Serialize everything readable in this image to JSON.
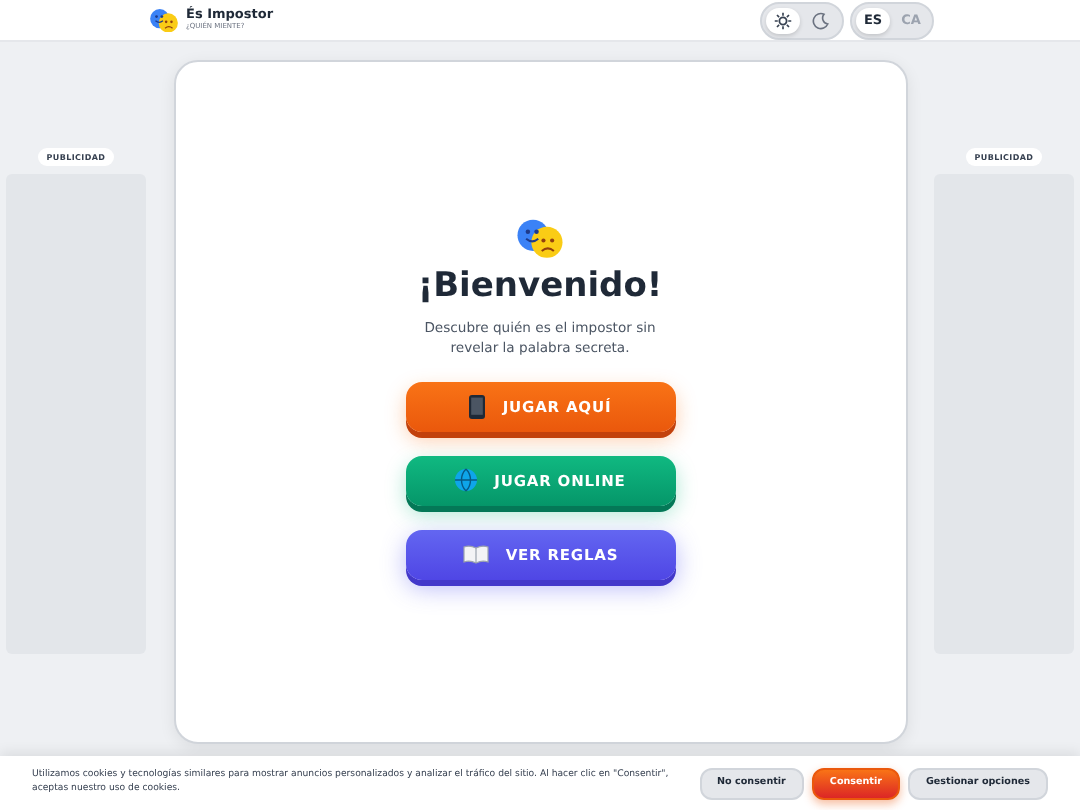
{
  "header": {
    "title": "És Impostor",
    "subtitle": "¿QUIÉN MIENTE?",
    "theme": [
      {
        "kind": "light",
        "selected": true
      },
      {
        "kind": "dark",
        "selected": false
      }
    ],
    "languages": [
      {
        "label": "ES",
        "selected": true
      },
      {
        "label": "CA",
        "selected": false
      }
    ]
  },
  "ads": [
    {
      "label": "PUBLICIDAD"
    },
    {
      "label": "PUBLICIDAD"
    }
  ],
  "main": {
    "title": "¡Bienvenido!",
    "description": "Descubre quién es el impostor sin revelar la palabra secreta.",
    "buttons": [
      {
        "kind": "local",
        "label": "JUGAR AQUÍ"
      },
      {
        "kind": "online",
        "label": "JUGAR ONLINE"
      },
      {
        "kind": "rules",
        "label": "VER REGLAS"
      }
    ]
  },
  "cookie_banner": {
    "text": "Utilizamos cookies y tecnologías similares para mostrar anuncios personalizados y analizar el tráfico del sitio. Al hacer clic en \"Consentir\", aceptas nuestro uso de cookies.",
    "buttons": [
      {
        "kind": "secondary",
        "label": "No consentir"
      },
      {
        "kind": "primary",
        "label": "Consentir"
      },
      {
        "kind": "secondary",
        "label": "Gestionar opciones"
      }
    ]
  }
}
